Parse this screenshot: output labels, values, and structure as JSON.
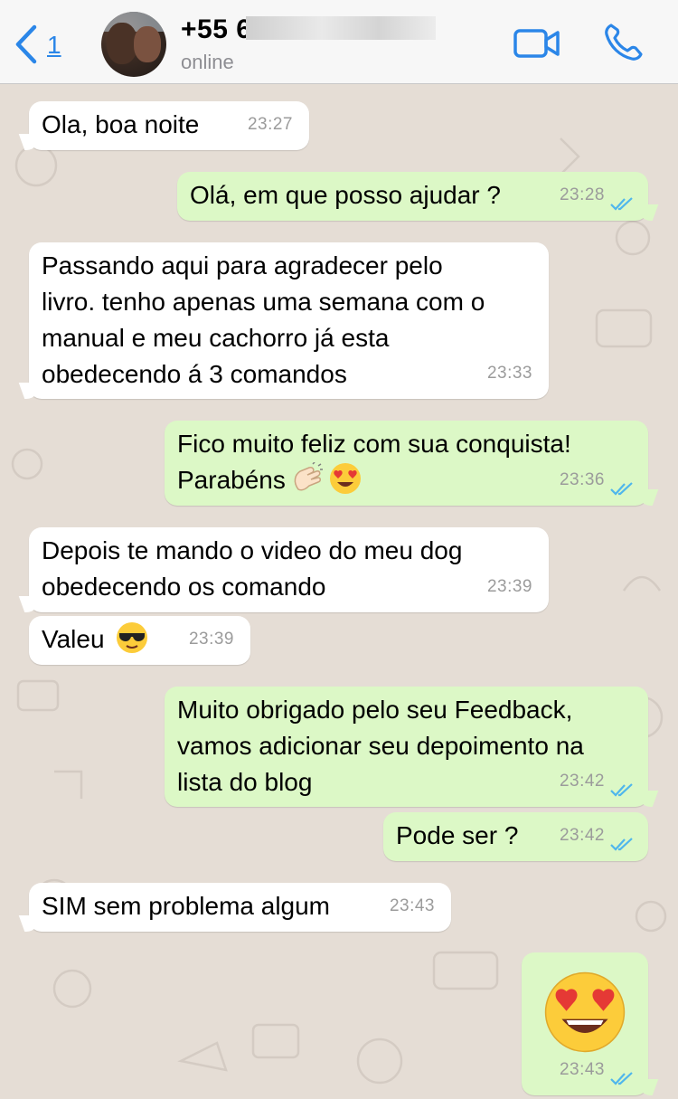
{
  "header": {
    "back_count": "1",
    "contact_name": "+55 6",
    "status": "online"
  },
  "colors": {
    "accent": "#2b86e8",
    "incoming_bubble": "#ffffff",
    "outgoing_bubble": "#dcf8c6",
    "chat_background": "#e5ddd5",
    "read_ticks": "#4fb6ec"
  },
  "messages": [
    {
      "direction": "in",
      "text": "Ola, boa noite",
      "time": "23:27"
    },
    {
      "direction": "out",
      "text": "Olá, em que posso ajudar ?",
      "time": "23:28",
      "read": true
    },
    {
      "direction": "in",
      "text": "Passando aqui para agradecer pelo\nlivro. tenho apenas uma semana com o\nmanual e meu cachorro já esta\nobedecendo á 3 comandos",
      "time": "23:33"
    },
    {
      "direction": "out",
      "text": "Fico muito feliz com sua conquista!\nParabéns",
      "emoji": [
        "clapping-hands-icon",
        "heart-eyes-icon"
      ],
      "time": "23:36",
      "read": true
    },
    {
      "direction": "in",
      "text": "Depois te mando o video do meu dog\nobedecendo os comando",
      "time": "23:39"
    },
    {
      "direction": "in",
      "text": "Valeu",
      "emoji": [
        "sunglasses-face-icon"
      ],
      "time": "23:39"
    },
    {
      "direction": "out",
      "text": "Muito obrigado pelo seu Feedback,\nvamos adicionar seu depoimento na\nlista do blog",
      "time": "23:42",
      "read": true
    },
    {
      "direction": "out",
      "text": "Pode ser ?",
      "time": "23:42",
      "read": true
    },
    {
      "direction": "in",
      "text": "SIM sem problema algum",
      "time": "23:43"
    },
    {
      "direction": "out",
      "emoji": [
        "heart-eyes-icon"
      ],
      "time": "23:43",
      "read": true
    }
  ]
}
